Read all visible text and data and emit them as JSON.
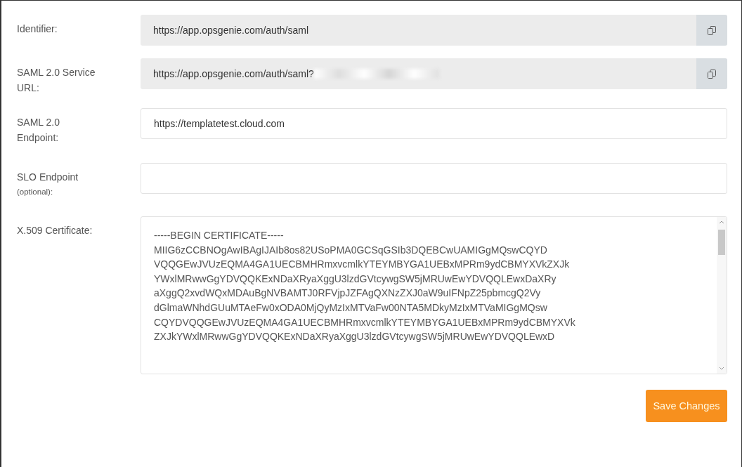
{
  "fields": [
    {
      "kind": "readonly",
      "label": "Identifier:",
      "value": "https://app.opsgenie.com/auth/saml",
      "redacted": false
    },
    {
      "kind": "readonly",
      "label": "SAML 2.0 Service URL:",
      "value": "https://app.opsgenie.com/auth/saml?",
      "redacted": true
    },
    {
      "kind": "input",
      "label": "SAML 2.0 Endpoint:",
      "value": "https://templatetest.cloud.com"
    },
    {
      "kind": "input",
      "label": "SLO Endpoint",
      "note": "(optional):"
    },
    {
      "kind": "textarea",
      "label": "X.509 Certificate:",
      "lines": [
        "-----BEGIN CERTIFICATE-----",
        "MIIG6zCCBNOgAwIBAgIJAIb8os82USoPMA0GCSqGSIb3DQEBCwUAMIGgMQswCQYD",
        "VQQGEwJVUzEQMA4GA1UECBMHRmxvcmlkYTEYMBYGA1UEBxMPRm9ydCBMYXVkZXJk",
        "YWxlMRwwGgYDVQQKExNDaXRyaXggU3lzdGVtcywgSW5jMRUwEwYDVQQLEwxDaXRy",
        "aXggQ2xvdWQxMDAuBgNVBAMTJ0RFVjpJZFAgQXNzZXJ0aW9uIFNpZ25pbmcgQ2Vy",
        "dGlmaWNhdGUuMTAeFw0xODA0MjQyMzIxMTVaFw00NTA5MDkyMzIxMTVaMIGgMQsw",
        "CQYDVQQGEwJVUzEQMA4GA1UECBMHRmxvcmlkYTEYMBYGA1UEBxMPRm9ydCBMYXVk",
        "ZXJkYWxlMRwwGgYDVQQKExNDaXRyaXggU3lzdGVtcywgSW5jMRUwEwYDVQQLEwxD"
      ]
    }
  ],
  "save_button": "Save Changes"
}
